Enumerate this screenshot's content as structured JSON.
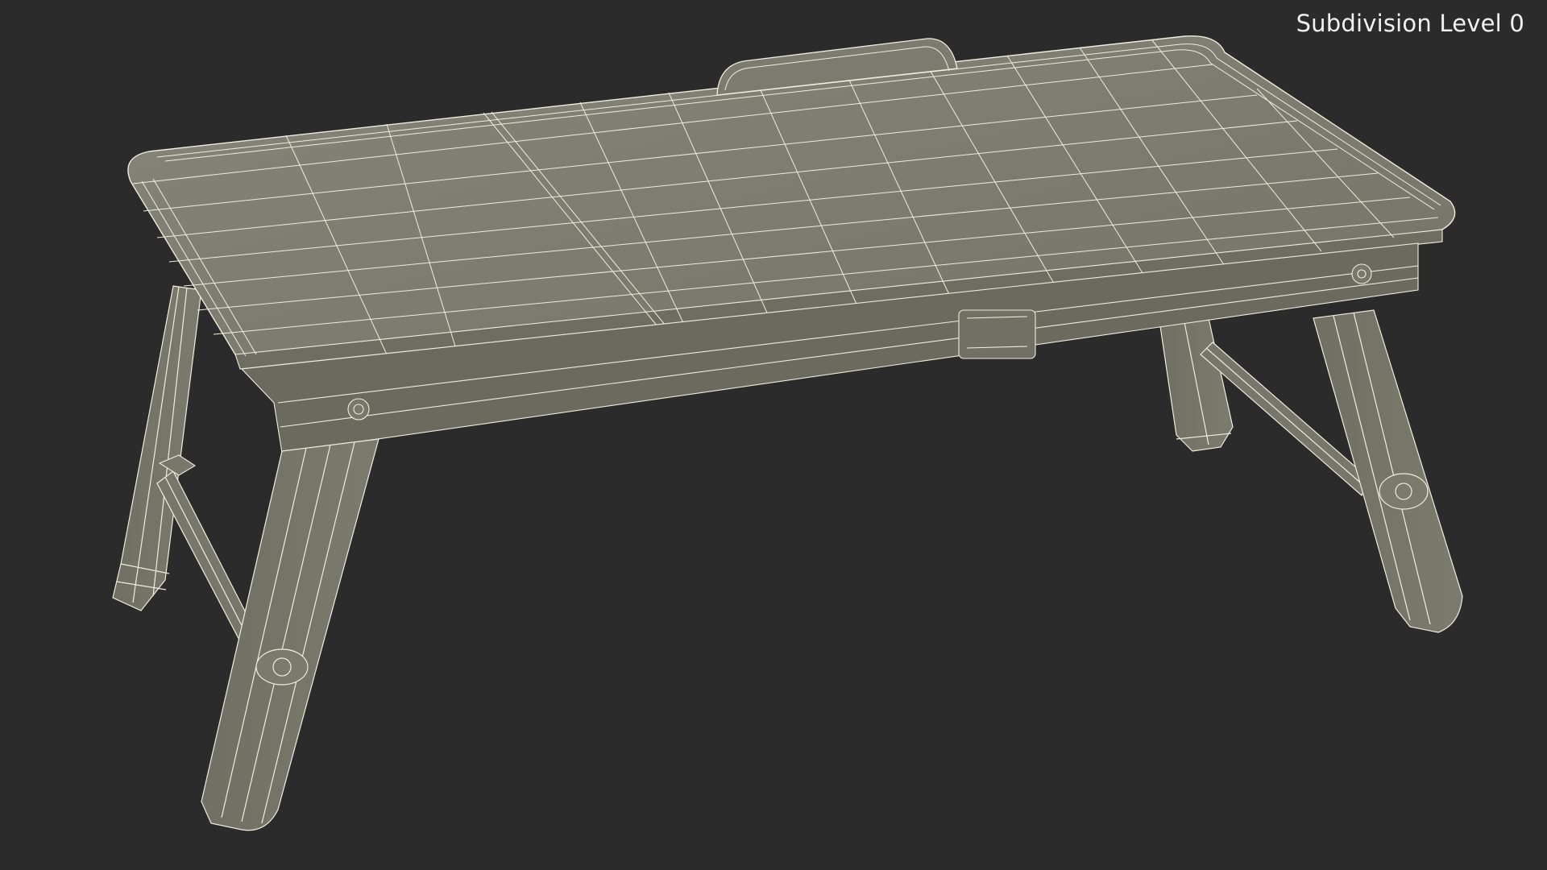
{
  "viewport": {
    "overlay_label": "Subdivision Level 0",
    "background_color": "#2b2b2b",
    "mesh_fill_color": "#7a7a6b",
    "wire_color": "#efeedd",
    "subject": "folding lap tray table wireframe render"
  }
}
